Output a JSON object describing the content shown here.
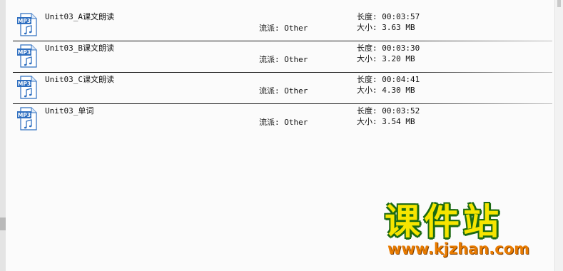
{
  "files": [
    {
      "name": "Unit03_A课文朗读",
      "genre": "流派: Other",
      "length": "长度: 00:03:57",
      "size": "大小: 3.63 MB",
      "icon": "mp3-file-icon"
    },
    {
      "name": "Unit03_B课文朗读",
      "genre": "流派: Other",
      "length": "长度: 00:03:30",
      "size": "大小: 3.20 MB",
      "icon": "mp3-file-icon"
    },
    {
      "name": "Unit03_C课文朗读",
      "genre": "流派: Other",
      "length": "长度: 00:04:41",
      "size": "大小: 4.30 MB",
      "icon": "mp3-file-icon"
    },
    {
      "name": "Unit03_单词",
      "genre": "流派: Other",
      "length": "长度: 00:03:52",
      "size": "大小: 3.54 MB",
      "icon": "mp3-file-icon"
    }
  ],
  "watermark": {
    "title": "课件站",
    "url": "www.kjzhan.com"
  },
  "colors": {
    "icon_blue": "#2f6fc0",
    "watermark_yellow": "#f6e500",
    "watermark_green": "#1c6a12",
    "watermark_orange": "#e87b00"
  }
}
